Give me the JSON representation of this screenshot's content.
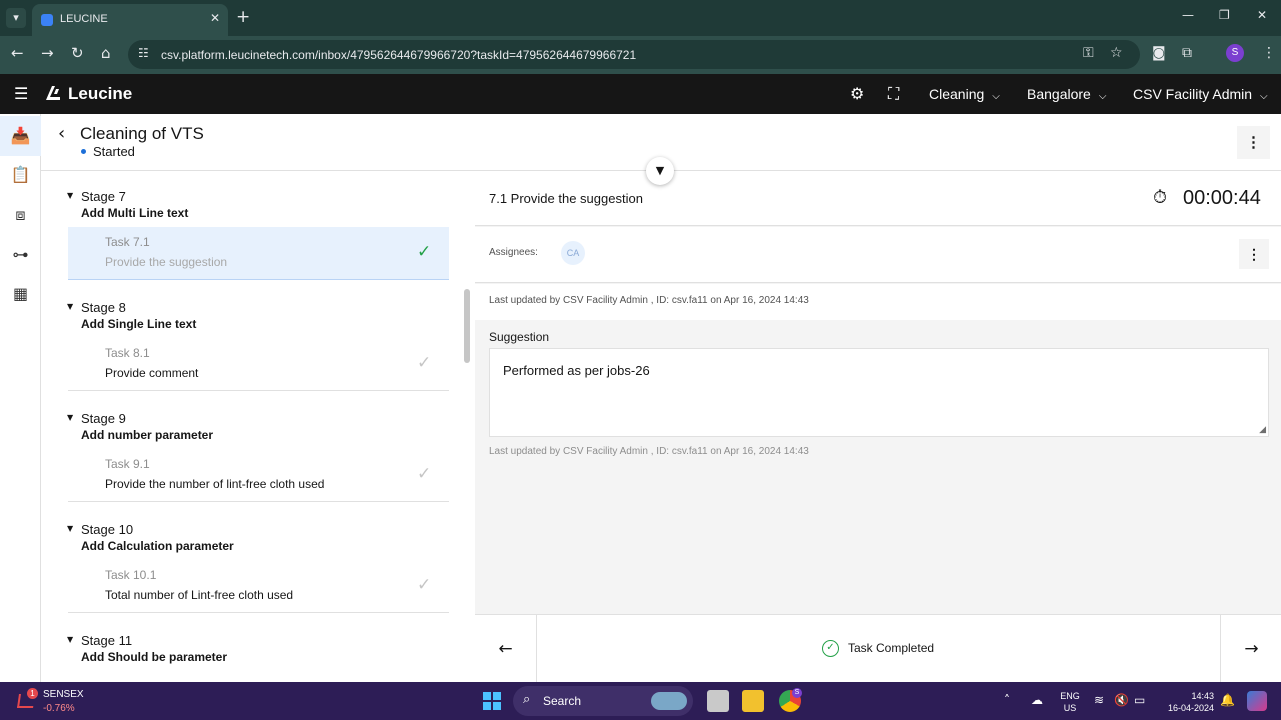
{
  "browser": {
    "tab_title": "LEUCINE",
    "url": "csv.platform.leucinetech.com/inbox/479562644679966720?taskId=479562644679966721",
    "profile_initial": "S",
    "icons": [
      "tab-list-icon",
      "favicon",
      "close-tab-icon",
      "new-tab-icon",
      "minimize-icon",
      "maximize-icon",
      "close-window-icon",
      "back-icon",
      "forward-icon",
      "reload-icon",
      "home-icon",
      "site-info-icon",
      "password-key-icon",
      "bookmark-star-icon",
      "camera-icon",
      "extensions-icon",
      "menu-icon"
    ]
  },
  "app_header": {
    "logo_text": "Leucine",
    "use_case": "Cleaning",
    "facility": "Bangalore",
    "user_role": "CSV Facility Admin",
    "icons": [
      "hamburger-icon",
      "settings-gear-icon",
      "scan-icon",
      "chevron-down-icon"
    ]
  },
  "side_rail": {
    "items": [
      "inbox-icon",
      "checklist-icon",
      "ontology-icon",
      "hierarchy-icon",
      "calculator-icon"
    ],
    "active_index": 0
  },
  "page": {
    "title": "Cleaning of VTS",
    "status": "Started"
  },
  "stages": [
    {
      "stage_no": "Stage 7",
      "stage_name": "Add Multi Line text",
      "task_no": "Task 7.1",
      "task_name": "Provide the suggestion",
      "active": true
    },
    {
      "stage_no": "Stage 8",
      "stage_name": "Add Single Line text",
      "task_no": "Task 8.1",
      "task_name": "Provide comment",
      "active": false
    },
    {
      "stage_no": "Stage 9",
      "stage_name": "Add number parameter",
      "task_no": "Task 9.1",
      "task_name": "Provide the number of lint-free cloth used",
      "active": false
    },
    {
      "stage_no": "Stage 10",
      "stage_name": "Add Calculation parameter",
      "task_no": "Task 10.1",
      "task_name": "Total number of Lint-free cloth used",
      "active": false
    },
    {
      "stage_no": "Stage 11",
      "stage_name": "Add Should be parameter",
      "task_no": "",
      "task_name": "",
      "active": false
    }
  ],
  "task": {
    "title": "7.1 Provide the suggestion",
    "timer": "00:00:44",
    "assignees_label": "Assignees:",
    "assignee_initials": "CA",
    "last_updated": "Last updated by CSV Facility Admin , ID: csv.fa11 on Apr 16, 2024 14:43",
    "parameter_label": "Suggestion",
    "parameter_value": "Performed as per jobs-26",
    "parameter_updated": "Last updated by CSV Facility Admin , ID: csv.fa11 on Apr 16, 2024 14:43",
    "completed_label": "Task Completed"
  },
  "taskbar": {
    "stock_name": "SENSEX",
    "stock_change": "-0.76%",
    "stock_badge": "1",
    "search_placeholder": "Search",
    "lang_line1": "ENG",
    "lang_line2": "US",
    "time": "14:43",
    "date": "16-04-2024",
    "chrome_badge": "S"
  },
  "colors": {
    "accent": "#1d6fd8",
    "success": "#24a148",
    "header_bg": "#161616",
    "browser_bg": "#2f4f4b",
    "taskbar_bg": "#2d1d56"
  }
}
